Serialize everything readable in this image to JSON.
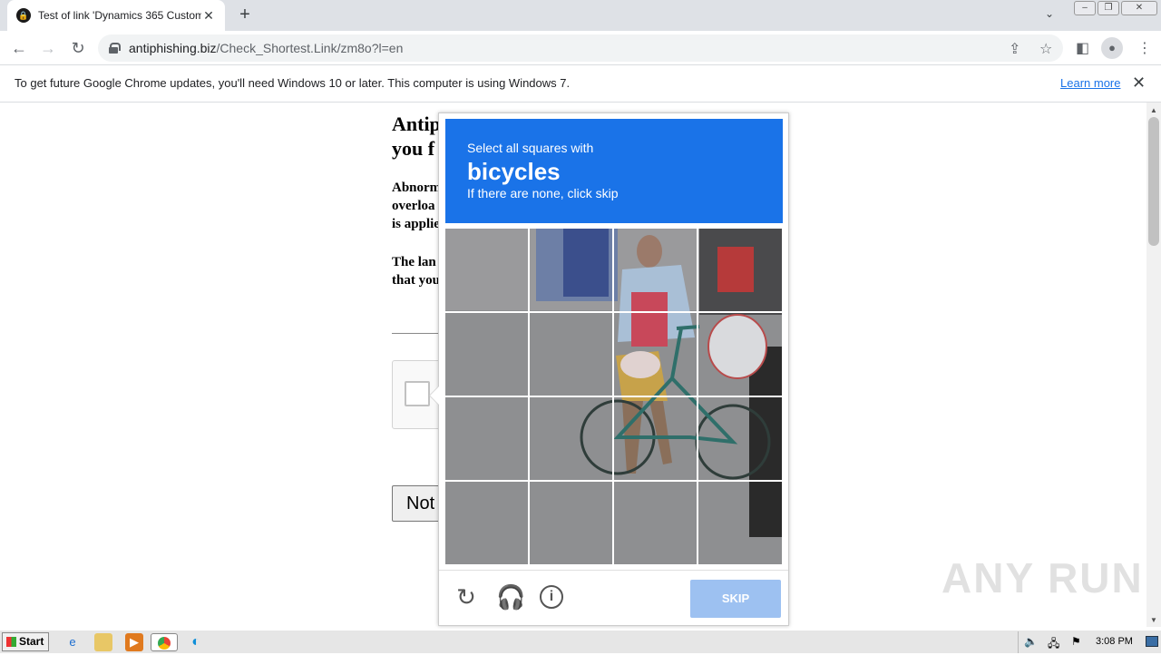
{
  "browser": {
    "tab_title": "Test of link 'Dynamics 365 Customer",
    "tab_close": "✕",
    "new_tab": "+",
    "url_host": "antiphishing.biz",
    "url_path": "/Check_Shortest.Link/zm8o?l=en",
    "avatar_glyph": "●"
  },
  "infobar": {
    "message": "To get future Google Chrome updates, you'll need Windows 10 or later. This computer is using Windows 7.",
    "learn_more": "Learn more",
    "close": "✕"
  },
  "page": {
    "heading": "Antip \nyou f",
    "para1_l1": "Abnorm",
    "para1_l2": "overloa",
    "para1_l3": "is applie",
    "para2_l1": "The lan",
    "para2_l2": "that you",
    "not_button": "Not"
  },
  "captcha": {
    "instruction": "Select all squares with",
    "target": "bicycles",
    "hint": "If there are none, click skip",
    "skip_label": "SKIP",
    "tiles": 16
  },
  "taskbar": {
    "start_label": "Start",
    "clock": "3:08 PM"
  },
  "watermark": "ANY RUN",
  "colors": {
    "accent": "#1a73e8",
    "skip_disabled": "#9dc1f1",
    "chrome_frame": "#dee1e6"
  }
}
